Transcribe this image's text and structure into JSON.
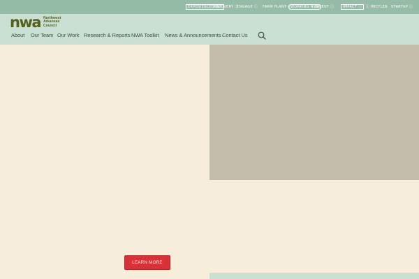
{
  "partners": [
    {
      "label": "EXPERIENCE NWA",
      "style": "boxed"
    },
    {
      "label": "DISCOVERY ⓘ",
      "style": "plain"
    },
    {
      "label": "ENGAGE ⓘ",
      "style": "plain"
    },
    {
      "label": "FARM PLANT ⓘ",
      "style": "plain"
    },
    {
      "label": "WORKING NWA",
      "style": "pill"
    },
    {
      "label": "INVEST ⓘ",
      "style": "plain"
    },
    {
      "label": "IMPACT ⓘ",
      "style": "boxed"
    },
    {
      "label": "ⓘ MICYLER",
      "style": "plain"
    },
    {
      "label": "STARTUP ⓘ",
      "style": "plain"
    }
  ],
  "logo": {
    "mark": "nwa",
    "line1": "Northwest",
    "line2": "Arkansas",
    "line3": "Council"
  },
  "nav": {
    "items": [
      "About",
      "Our Team",
      "Our Work",
      "Research & Reports",
      "NWA Toolkit",
      "News & Announcements",
      "Contact Us"
    ],
    "search_icon": "search-icon"
  },
  "cta": {
    "learn_more": "LEARN MORE"
  },
  "colors": {
    "topbar": "#95bca7",
    "navbar": "#c9e0d2",
    "page": "#f7eddb",
    "panel": "#c2bdab",
    "logo": "#56611e",
    "button": "#d63237"
  }
}
